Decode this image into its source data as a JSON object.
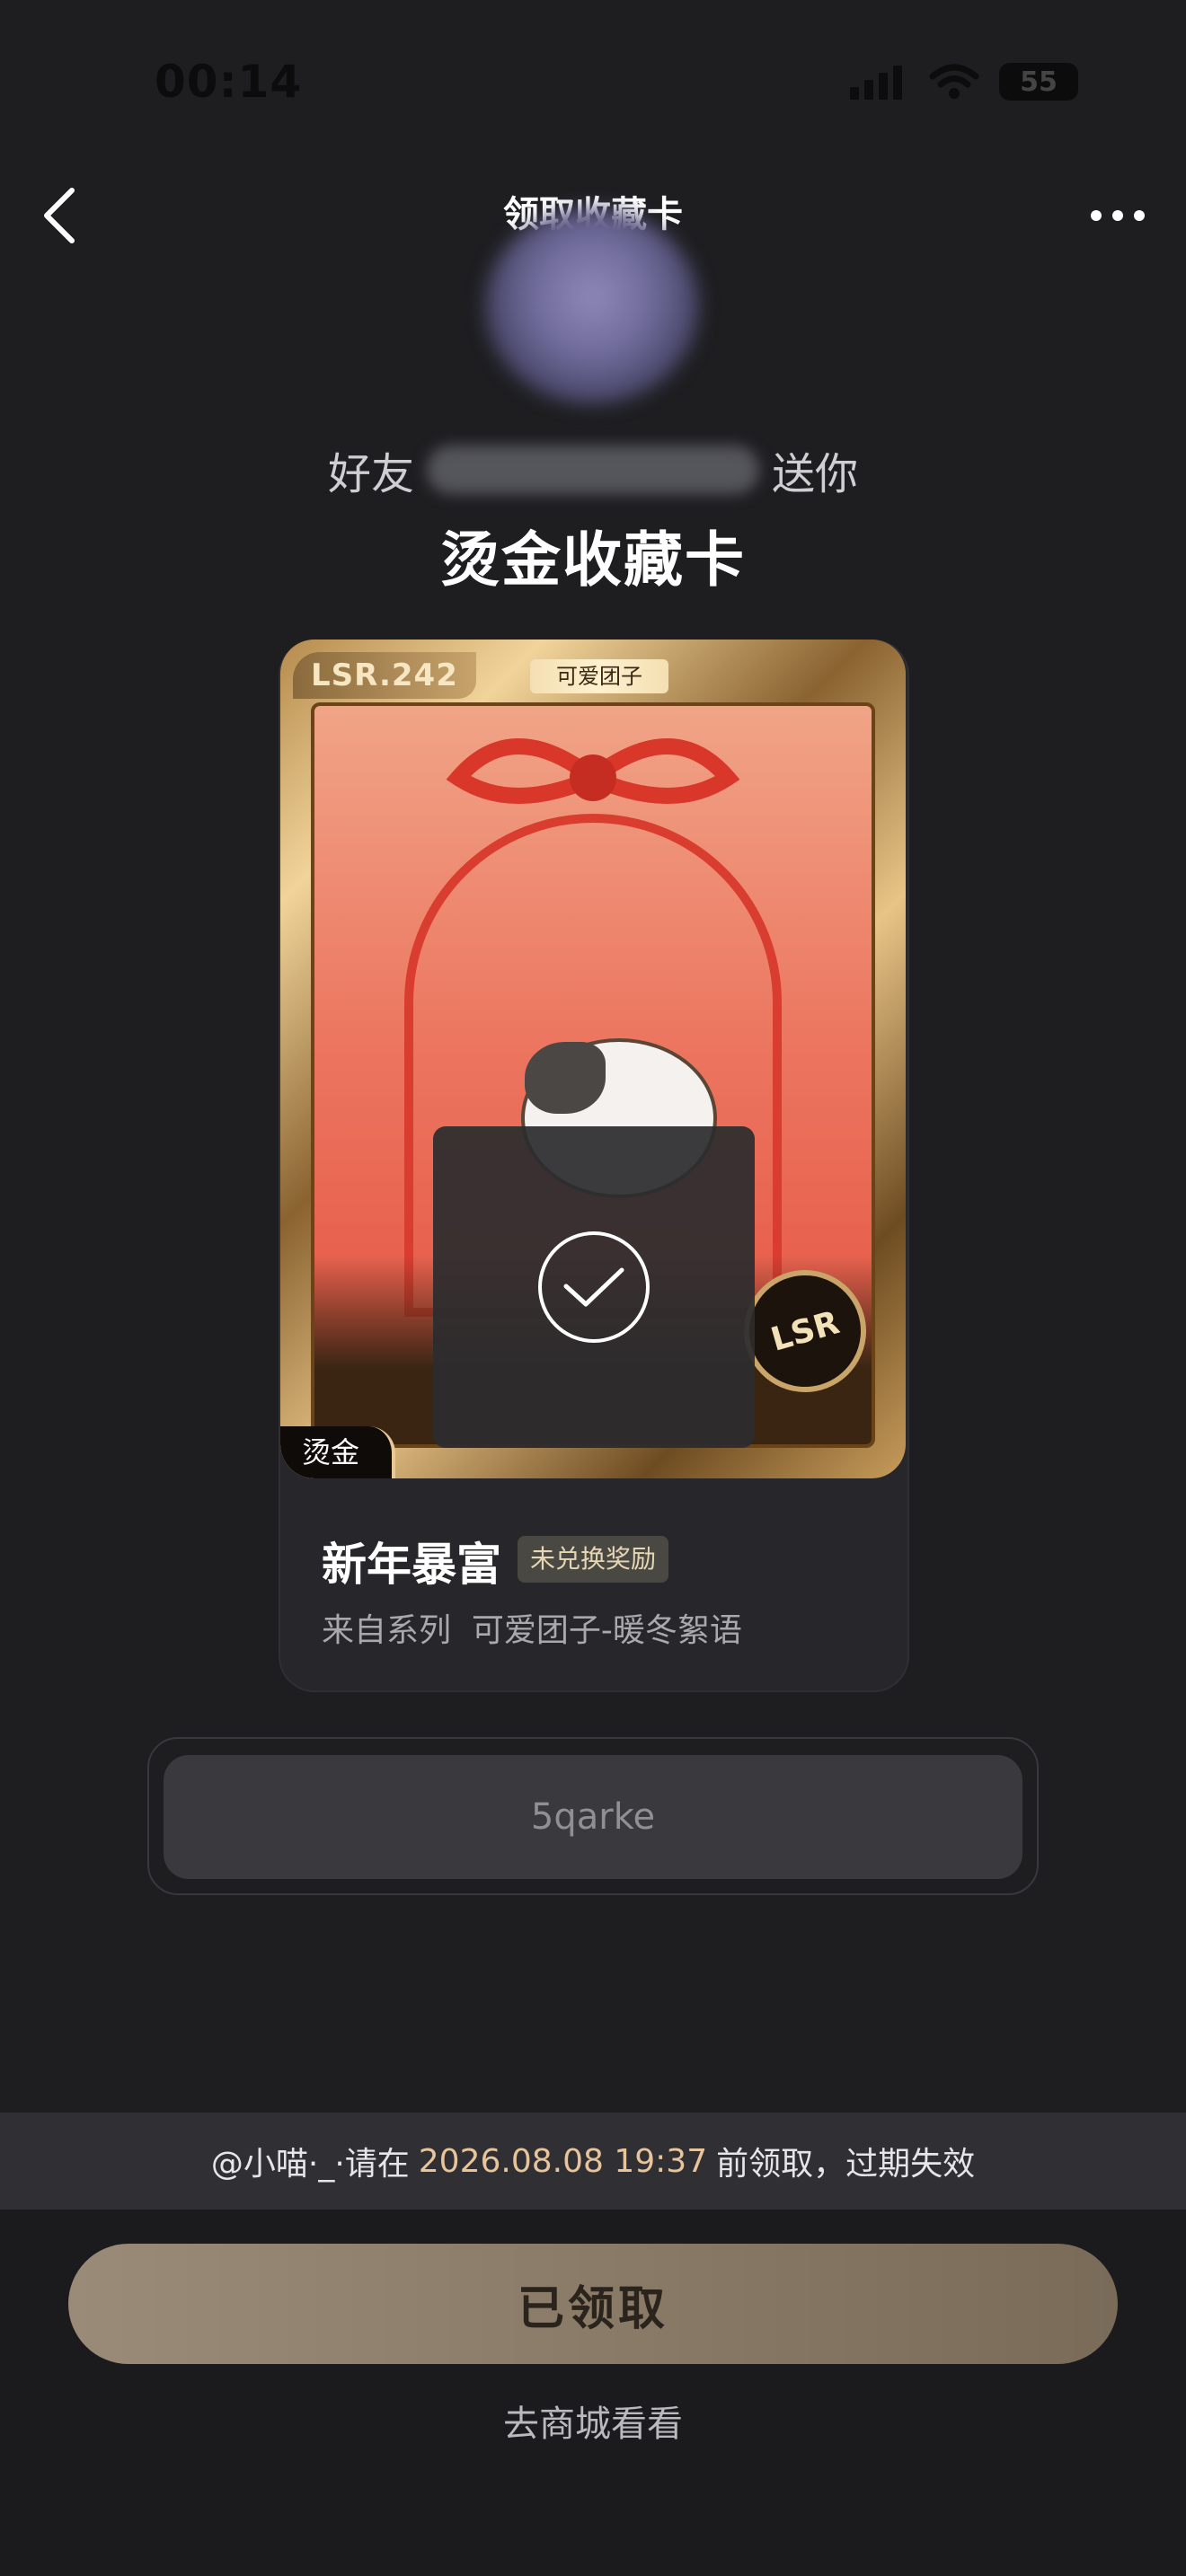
{
  "status_bar": {
    "time": "00:14",
    "battery": "55"
  },
  "nav": {
    "title": "领取收藏卡"
  },
  "header": {
    "friend_prefix": "好友",
    "friend_suffix": "送你",
    "gift_title": "烫金收藏卡"
  },
  "card": {
    "rarity_number": "LSR.242",
    "series_tag": "可爱团子",
    "rarity_badge": "LSR",
    "finish_tag": "烫金",
    "name": "新年暴富",
    "reward_status": "未兑换奖励",
    "series_label": "来自系列",
    "series_name": "可爱团子-暖冬絮语"
  },
  "code": {
    "value": "5qarke"
  },
  "notice": {
    "prefix": "@小喵·_·请在",
    "date": "2026.08.08 19:37",
    "suffix": "前领取，过期失效"
  },
  "actions": {
    "claimed_label": "已领取",
    "shop_link": "去商城看看"
  },
  "colors": {
    "background": "#1e1e21",
    "accent_gold": "#e8c49a",
    "button": "#8a7b68"
  }
}
